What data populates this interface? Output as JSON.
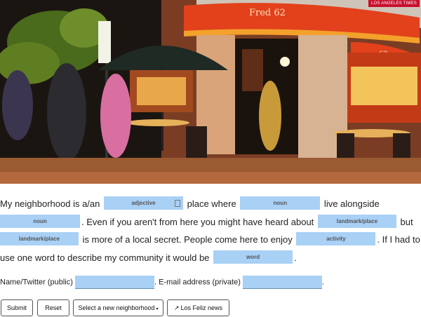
{
  "photo": {
    "credit": "LOS ANGELES TIMES",
    "awning_text": "Fred 62",
    "awning_number": "62"
  },
  "madlib": {
    "t1": "My neighborhood is a/an ",
    "b1": "adjective",
    "t2": " place where ",
    "b2": "noun",
    "t3": " live alongside",
    "b3": "noun",
    "t4": ". Even if you aren't from here you might have heard about ",
    "b4": "landmark/place",
    "t5": " but",
    "b5": "landmark/place",
    "t6": " is more of a local secret. People come here to enjoy ",
    "b6": "activity",
    "t7": ". If I had to use one word to describe my community it would be ",
    "b7": "word",
    "t8": "."
  },
  "contact": {
    "name_label": "Name/Twitter (public)",
    "email_label": ". E-mail address (private)",
    "end": "."
  },
  "buttons": {
    "submit": "Submit",
    "reset": "Reset",
    "select": "Select a new neighborhood",
    "select_caret": "▾",
    "news_icon": "↗",
    "news": "Los Feliz news"
  },
  "colors": {
    "blank": "#a9d0f5",
    "awning": "#e2411c"
  }
}
